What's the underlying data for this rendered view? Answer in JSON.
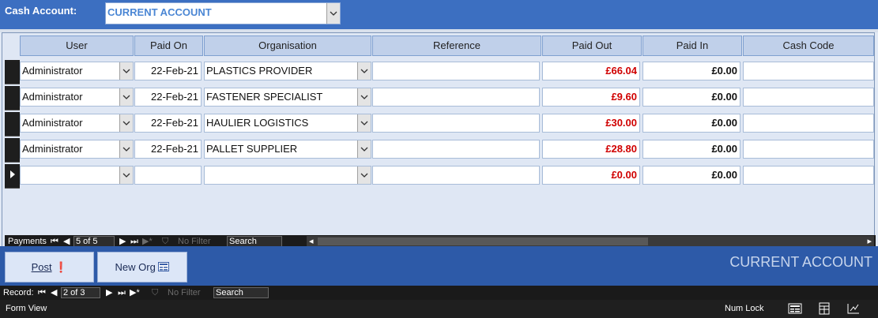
{
  "header": {
    "cash_account_label": "Cash Account:",
    "cash_account_value": "CURRENT ACCOUNT"
  },
  "columns": [
    "User",
    "Paid On",
    "Organisation",
    "Reference",
    "Paid Out",
    "Paid In",
    "Cash Code"
  ],
  "rows": [
    {
      "user": "Administrator",
      "paid_on": "22-Feb-21",
      "organisation": "PLASTICS PROVIDER",
      "reference": "",
      "paid_out": "£66.04",
      "paid_in": "£0.00",
      "cash_code": ""
    },
    {
      "user": "Administrator",
      "paid_on": "22-Feb-21",
      "organisation": "FASTENER SPECIALIST",
      "reference": "",
      "paid_out": "£9.60",
      "paid_in": "£0.00",
      "cash_code": ""
    },
    {
      "user": "Administrator",
      "paid_on": "22-Feb-21",
      "organisation": "HAULIER LOGISTICS",
      "reference": "",
      "paid_out": "£30.00",
      "paid_in": "£0.00",
      "cash_code": ""
    },
    {
      "user": "Administrator",
      "paid_on": "22-Feb-21",
      "organisation": "PALLET SUPPLIER",
      "reference": "",
      "paid_out": "£28.80",
      "paid_in": "£0.00",
      "cash_code": ""
    },
    {
      "user": "",
      "paid_on": "",
      "organisation": "",
      "reference": "",
      "paid_out": "£0.00",
      "paid_in": "£0.00",
      "cash_code": ""
    }
  ],
  "subform_nav": {
    "label": "Payments",
    "position": "5 of 5",
    "filter": "No Filter",
    "search": "Search"
  },
  "buttons": {
    "post": "Post",
    "new_org": "New Org"
  },
  "account_title": "CURRENT ACCOUNT",
  "record_nav": {
    "label": "Record:",
    "position": "2 of 3",
    "filter": "No Filter",
    "search": "Search"
  },
  "status_bar": {
    "view": "Form View",
    "num_lock": "Num Lock"
  },
  "colors": {
    "header_blue": "#3c6fc1",
    "paid_out_red": "#d00000",
    "account_value_blue": "#4a86d4"
  }
}
